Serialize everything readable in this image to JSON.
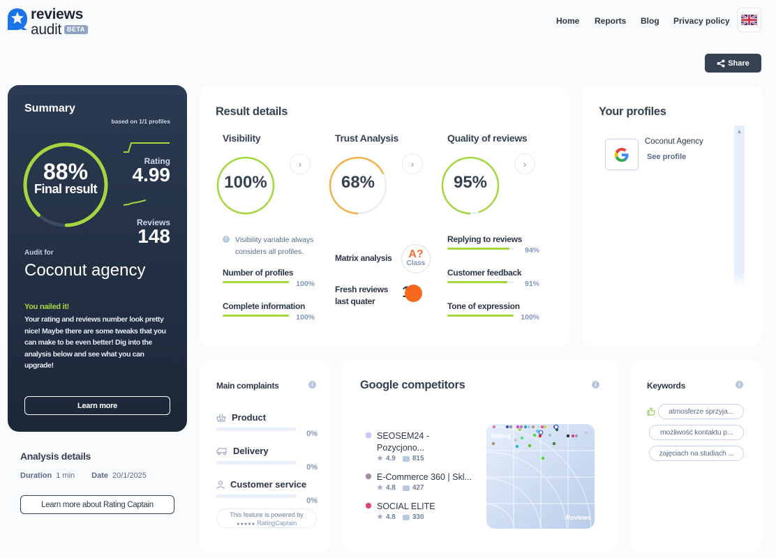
{
  "header": {
    "logo_top": "reviews",
    "logo_bottom": "audit",
    "beta": "BETA",
    "nav": [
      "Home",
      "Reports",
      "Blog",
      "Privacy policy"
    ],
    "language": "EN",
    "share_label": "Share"
  },
  "summary": {
    "title": "Summary",
    "based_on": "based on 1/1 profiles",
    "final_pct": "88%",
    "final_value": 0.88,
    "final_label": "Final result",
    "rating_label": "Rating",
    "rating_value": "4.99",
    "reviews_label": "Reviews",
    "reviews_value": "148",
    "audit_for_label": "Audit for",
    "company": "Coconut agency",
    "headline": "You nailed it!",
    "message": "Your rating and reviews number look pretty nice! Maybe there are some tweaks that you can make to be even better! Dig into the analysis below and see what you can upgrade!",
    "learn_more": "Learn more"
  },
  "analysis": {
    "title": "Analysis details",
    "duration_label": "Duration",
    "duration_value": "1 min",
    "date_label": "Date",
    "date_value": "20/1/2025",
    "button": "Learn more about Rating Captain"
  },
  "results": {
    "title": "Result details",
    "columns": [
      {
        "title": "Visibility",
        "value_text": "100%",
        "value": 1.0,
        "color": "#a6d63f",
        "note": "Visibility variable always considers all profiles.",
        "metrics": [
          {
            "label": "Number of profiles",
            "value_text": "100%",
            "value": 1.0
          },
          {
            "label": "Complete information",
            "value_text": "100%",
            "value": 1.0
          }
        ]
      },
      {
        "title": "Trust Analysis",
        "value_text": "68%",
        "value": 0.68,
        "color": "#f5b04a",
        "matrix_label": "Matrix analysis",
        "class_letter": "A?",
        "class_label": "Class",
        "fresh_label_1": "Fresh reviews",
        "fresh_label_2": "last quater",
        "fresh_value": "1"
      },
      {
        "title": "Quality of reviews",
        "value_text": "95%",
        "value": 0.95,
        "color": "#a6d63f",
        "metrics": [
          {
            "label": "Replying to reviews",
            "value_text": "94%",
            "value": 0.94
          },
          {
            "label": "Customer feedback",
            "value_text": "91%",
            "value": 0.91
          },
          {
            "label": "Tone of expression",
            "value_text": "100%",
            "value": 1.0
          }
        ]
      }
    ]
  },
  "profiles": {
    "title": "Your profiles",
    "items": [
      {
        "name": "Coconut Agency",
        "link": "See profile",
        "icon": "google-icon"
      }
    ]
  },
  "complaints": {
    "title": "Main complaints",
    "items": [
      {
        "label": "Product",
        "value_text": "0%",
        "icon": "basket-icon"
      },
      {
        "label": "Delivery",
        "value_text": "0%",
        "icon": "van-icon"
      },
      {
        "label": "Customer service",
        "value_text": "0%",
        "icon": "person-icon"
      }
    ],
    "powered_1": "This feature is powered by",
    "powered_2": "RatingCaptain",
    "powered_stars": "★★★★★"
  },
  "competitors": {
    "title": "Google competitors",
    "items": [
      {
        "name": "SEOSEM24 - Pozycjono...",
        "rating": "4.9",
        "reviews": "815",
        "color": "#c9c3f7"
      },
      {
        "name": "E-Commerce 360 | Skl...",
        "rating": "4.8",
        "reviews": "427",
        "color": "#a08c9c"
      },
      {
        "name": "SOCIAL ELITE",
        "rating": "4.8",
        "reviews": "330",
        "color": "#e0426e"
      }
    ],
    "chart": {
      "y_label": "Rating",
      "x_label": "Reviews"
    }
  },
  "keywords": {
    "title": "Keywords",
    "items": [
      {
        "text": "atmosferze sprzyja...",
        "positive": true
      },
      {
        "text": "możliwość kontaktu p...",
        "positive": false
      },
      {
        "text": "zajęciach na studiach ...",
        "positive": false
      }
    ]
  }
}
